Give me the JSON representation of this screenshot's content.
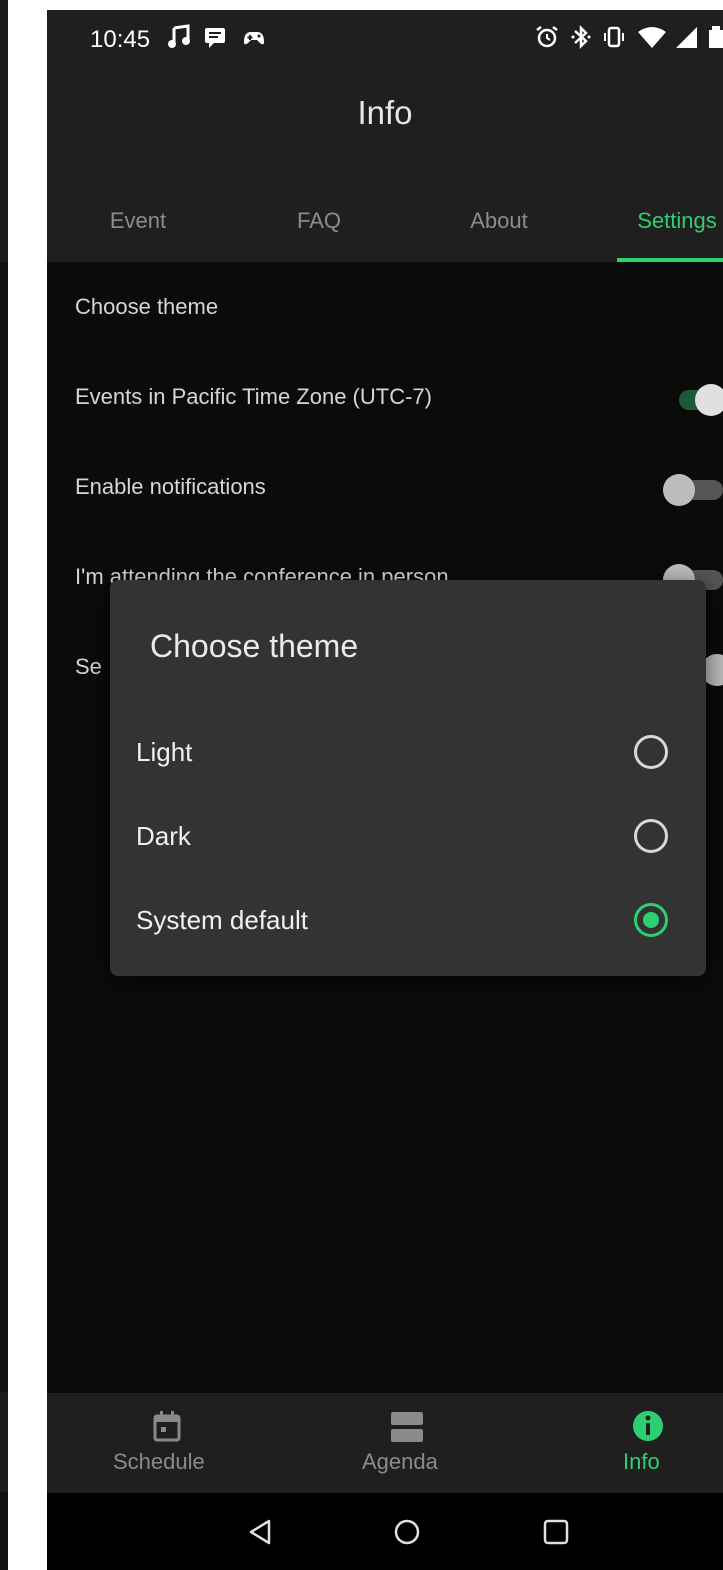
{
  "status_bar": {
    "time": "10:45"
  },
  "app_bar": {
    "title": "Info"
  },
  "tabs": [
    {
      "label": "Event"
    },
    {
      "label": "FAQ"
    },
    {
      "label": "About"
    },
    {
      "label": "Settings"
    }
  ],
  "settings": {
    "choose_theme": "Choose theme",
    "pacific_time": "Events in Pacific Time Zone (UTC-7)",
    "notifications": "Enable notifications",
    "attending": "I'm attending the conference in person",
    "partial_label": "Se"
  },
  "dialog": {
    "title": "Choose theme",
    "options": [
      {
        "label": "Light",
        "selected": false
      },
      {
        "label": "Dark",
        "selected": false
      },
      {
        "label": "System default",
        "selected": true
      }
    ]
  },
  "bottom_nav": [
    {
      "label": "Schedule",
      "icon": "calendar-icon"
    },
    {
      "label": "Agenda",
      "icon": "agenda-icon"
    },
    {
      "label": "Info",
      "icon": "info-icon"
    }
  ],
  "colors": {
    "accent": "#2ecf73",
    "app_bar": "#1f1f1f",
    "background": "#0b0b0b",
    "dialog": "#333333"
  }
}
